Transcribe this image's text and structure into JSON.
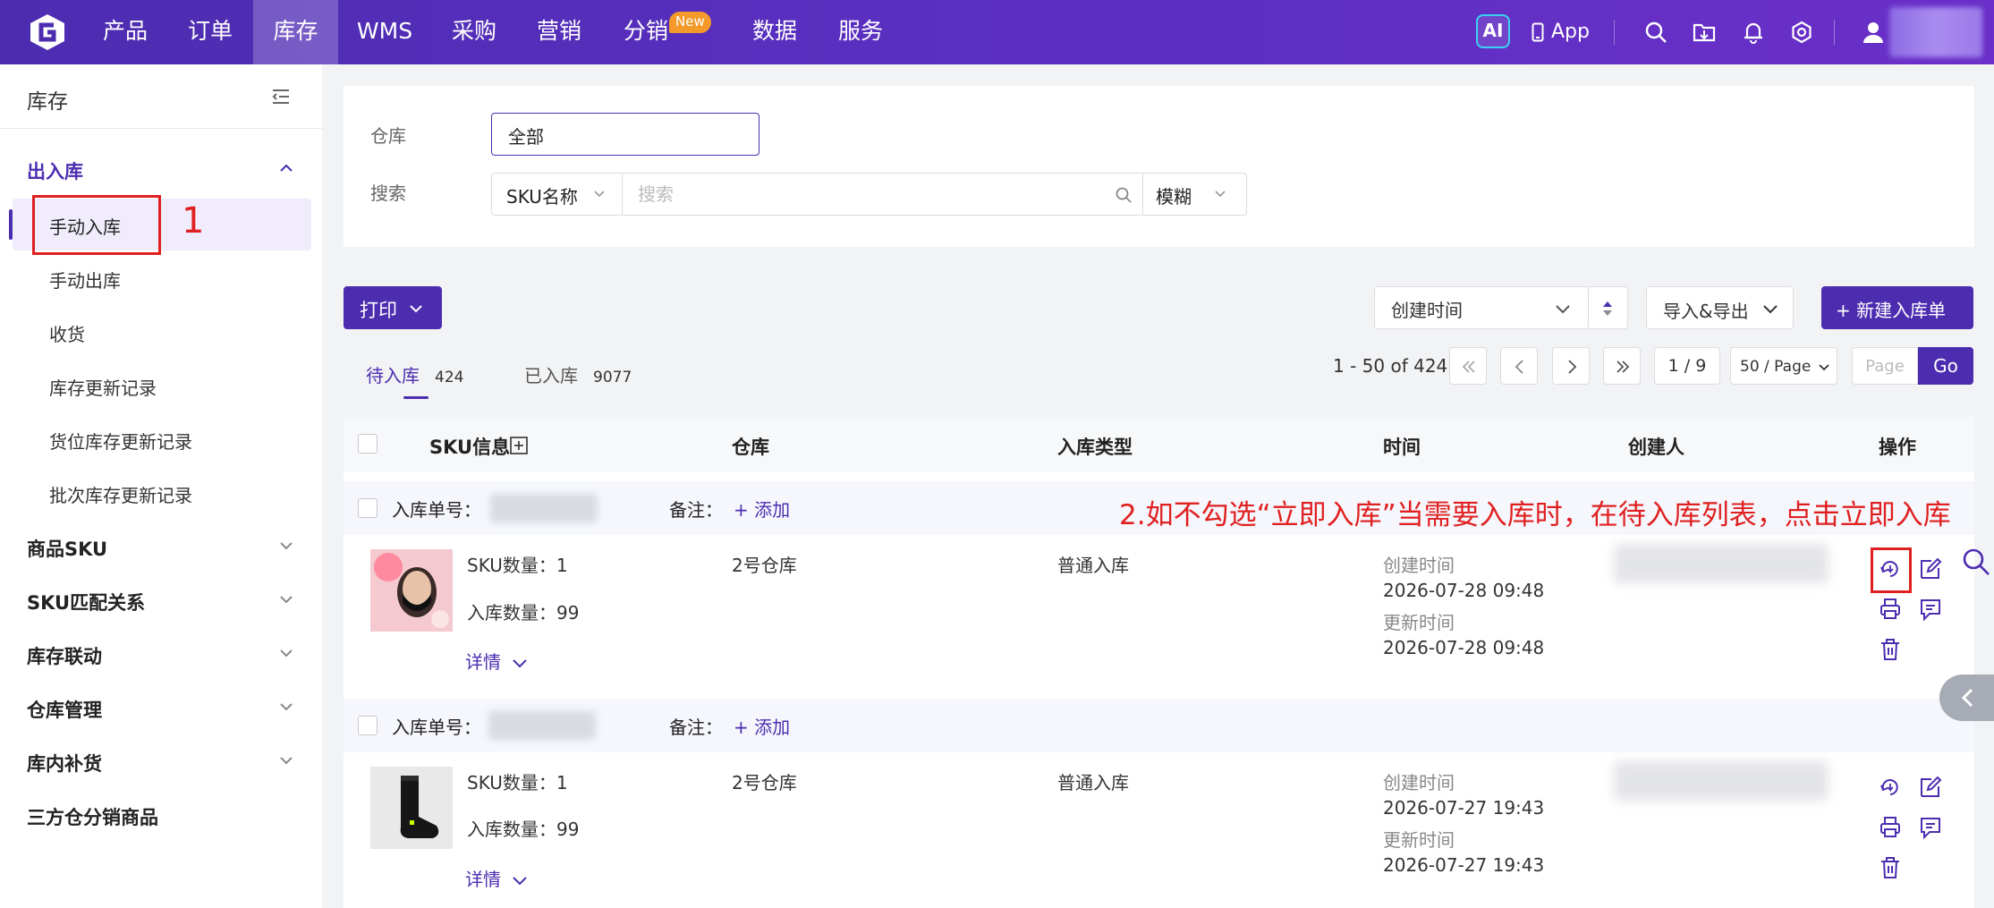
{
  "topbar": {
    "nav": [
      "产品",
      "订单",
      "库存",
      "WMS",
      "采购",
      "营销",
      "分销",
      "数据",
      "服务"
    ],
    "active_nav": "库存",
    "new_badge": "New",
    "ai_label": "AI",
    "app_label": "App"
  },
  "sidebar": {
    "title": "库存",
    "group_inout": "出入库",
    "items": [
      "手动入库",
      "手动出库",
      "收货",
      "库存更新记录",
      "货位库存更新记录",
      "批次库存更新记录"
    ],
    "groups": [
      "商品SKU",
      "SKU匹配关系",
      "库存联动",
      "仓库管理",
      "库内补货",
      "三方仓分销商品"
    ],
    "step_marker": "1"
  },
  "filter": {
    "warehouse_label": "仓库",
    "warehouse_value": "全部",
    "search_label": "搜索",
    "search_type": "SKU名称",
    "search_placeholder": "搜索",
    "search_mode": "模糊"
  },
  "toolbar": {
    "print_label": "打印",
    "sort_label": "创建时间",
    "import_export_label": "导入&导出",
    "new_label": "+ 新建入库单"
  },
  "tabs": [
    {
      "label": "待入库",
      "count": "424"
    },
    {
      "label": "已入库",
      "count": "9077"
    }
  ],
  "pagination": {
    "range": "1 - 50 of 424",
    "current": "1 / 9",
    "page_size": "50 / Page",
    "page_placeholder": "Page",
    "go_label": "Go"
  },
  "table": {
    "headers": [
      "SKU信息",
      "仓库",
      "入库类型",
      "时间",
      "创建人",
      "操作"
    ],
    "order_no_label": "入库单号：",
    "remark_label": "备注：",
    "add_label": "+ 添加",
    "detail_label": "详情",
    "sku_qty_label": "SKU数量：",
    "in_qty_label": "入库数量：",
    "created_label": "创建时间",
    "updated_label": "更新时间",
    "rows": [
      {
        "sku_qty": "1",
        "in_qty": "99",
        "warehouse": "2号仓库",
        "type": "普通入库",
        "created": "2026-07-28 09:48",
        "updated": "2026-07-28 09:48"
      },
      {
        "sku_qty": "1",
        "in_qty": "99",
        "warehouse": "2号仓库",
        "type": "普通入库",
        "created": "2026-07-27 19:43",
        "updated": "2026-07-27 19:43"
      }
    ]
  },
  "annotation": "2.如不勾选“立即入库”当需要入库时，在待入库列表，点击立即入库",
  "colors": {
    "brand": "#4c2db0",
    "annotation_red": "#e02020"
  }
}
